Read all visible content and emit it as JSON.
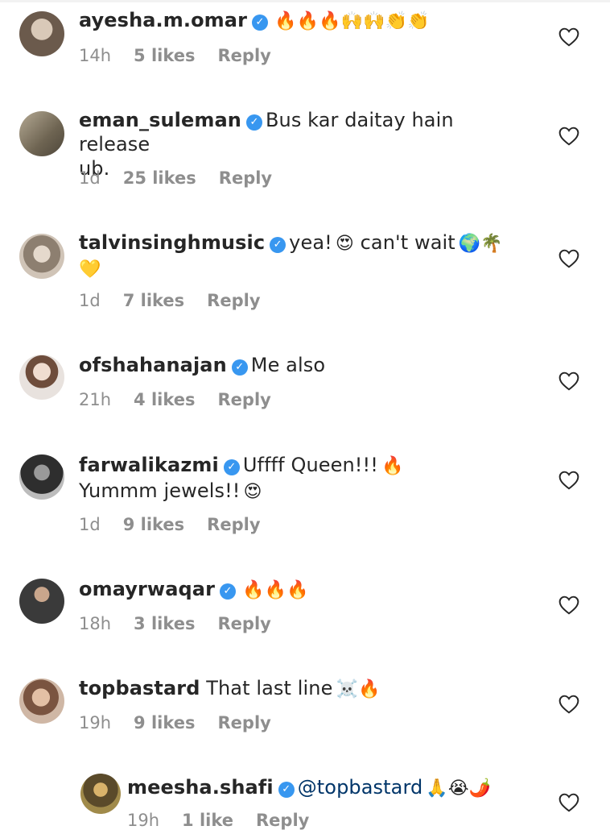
{
  "comments": [
    {
      "username": "ayesha.m.omar",
      "verified": true,
      "text": "",
      "emoji": "🔥🔥🔥🙌🙌👏👏",
      "time": "14h",
      "likes": "5 likes",
      "reply": "Reply",
      "avatar_color": "#6b5a4c"
    },
    {
      "username": "eman_suleman",
      "verified": true,
      "text": "Bus kar daitay hain release",
      "text2": "ub.",
      "time": "1d",
      "likes": "25 likes",
      "reply": "Reply",
      "avatar_color": "#8a7f6d"
    },
    {
      "username": "talvinsinghmusic",
      "verified": true,
      "text": "yea!",
      "emoji": "😍",
      "text_b": "can't wait",
      "emoji_b": "🌍🌴",
      "emoji2": "💛",
      "time": "1d",
      "likes": "7 likes",
      "reply": "Reply",
      "avatar_color": "#9b8f82"
    },
    {
      "username": "ofshahanajan",
      "verified": true,
      "text": "Me also",
      "time": "21h",
      "likes": "4 likes",
      "reply": "Reply",
      "avatar_color": "#c9b8a8"
    },
    {
      "username": "farwalikazmi",
      "verified": true,
      "text": "Uffff Queen!!!",
      "emoji": "🔥",
      "text2": "Yummm jewels!!",
      "emoji2": "😍",
      "time": "1d",
      "likes": "9 likes",
      "reply": "Reply",
      "avatar_color": "#4a4a4a"
    },
    {
      "username": "omayrwaqar",
      "verified": true,
      "text": "",
      "emoji": "🔥🔥🔥",
      "time": "18h",
      "likes": "3 likes",
      "reply": "Reply",
      "avatar_color": "#3a3a3a"
    },
    {
      "username": "topbastard",
      "verified": false,
      "text": "That last line",
      "emoji": "☠️🔥",
      "time": "19h",
      "likes": "9 likes",
      "reply": "Reply",
      "avatar_color": "#a8866c"
    },
    {
      "username": "meesha.shafi",
      "verified": true,
      "mention": "@topbastard",
      "emoji": "🙏😭🌶️",
      "time": "19h",
      "likes": "1 like",
      "reply": "Reply",
      "avatar_color": "#7b6a3c"
    }
  ],
  "icons": {
    "verified": "checkmark-badge",
    "like": "heart-outline"
  },
  "colors": {
    "verified_blue": "#3897f0",
    "meta_gray": "#8e8e8e",
    "mention_blue": "#003569"
  }
}
